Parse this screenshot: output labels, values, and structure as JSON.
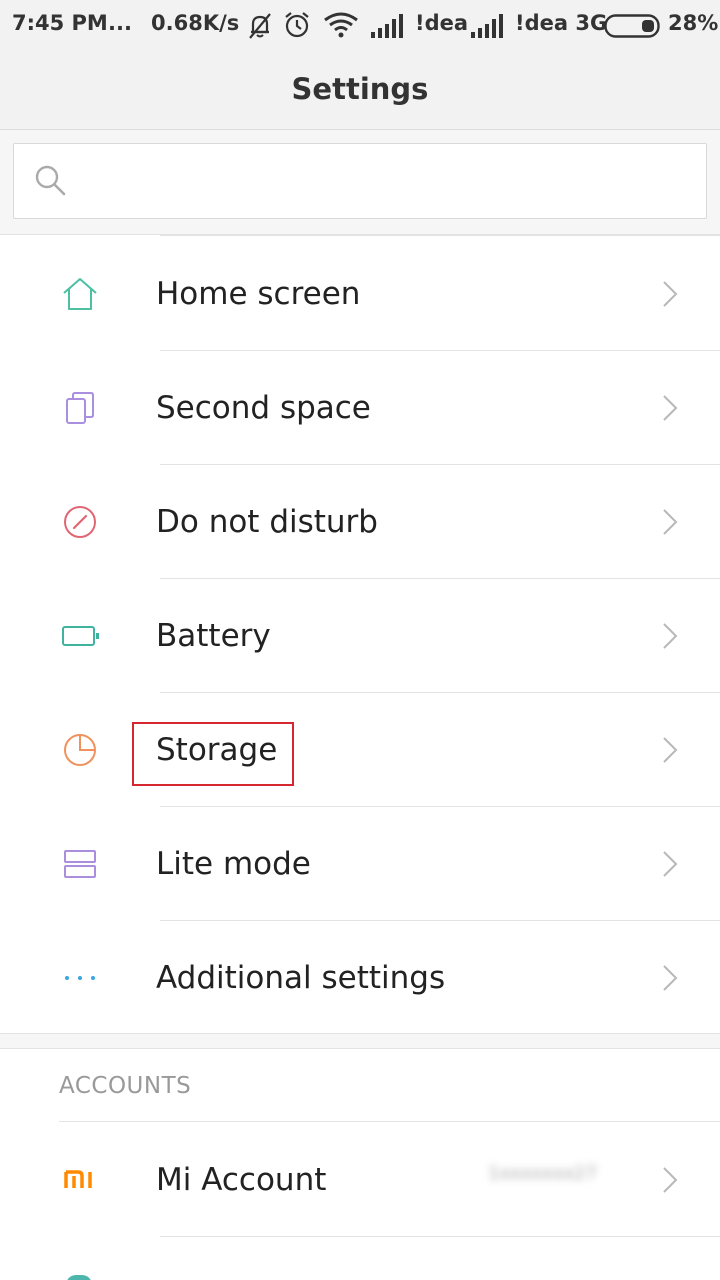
{
  "status_bar": {
    "time": "7:45 PM",
    "dots": "...",
    "speed": "0.68K/s",
    "carrier_1": "!dea",
    "carrier_2": "!dea 3G",
    "battery": "28%"
  },
  "header": {
    "title": "Settings"
  },
  "search": {
    "placeholder": "",
    "value": ""
  },
  "settings_items": [
    {
      "label": "Home screen",
      "icon": "home-icon"
    },
    {
      "label": "Second space",
      "icon": "second-space-icon"
    },
    {
      "label": "Do not disturb",
      "icon": "do-not-disturb-icon"
    },
    {
      "label": "Battery",
      "icon": "battery-icon"
    },
    {
      "label": "Storage",
      "icon": "storage-icon"
    },
    {
      "label": "Lite mode",
      "icon": "lite-mode-icon"
    },
    {
      "label": "Additional settings",
      "icon": "more-dots-icon"
    }
  ],
  "accounts": {
    "header": "ACCOUNTS",
    "items": [
      {
        "label": "Mi Account",
        "icon": "mi-logo-icon",
        "value": "1xxxxxxx27"
      }
    ]
  },
  "colors": {
    "home": "#4dbfa3",
    "second_space": "#a98fde",
    "dnd": "#e06673",
    "battery": "#3fb3a0",
    "storage": "#f0925c",
    "lite_mode": "#a98fde",
    "additional": "#3aa7dc",
    "mi": "#ff8a00",
    "highlight": "#d6262f"
  }
}
